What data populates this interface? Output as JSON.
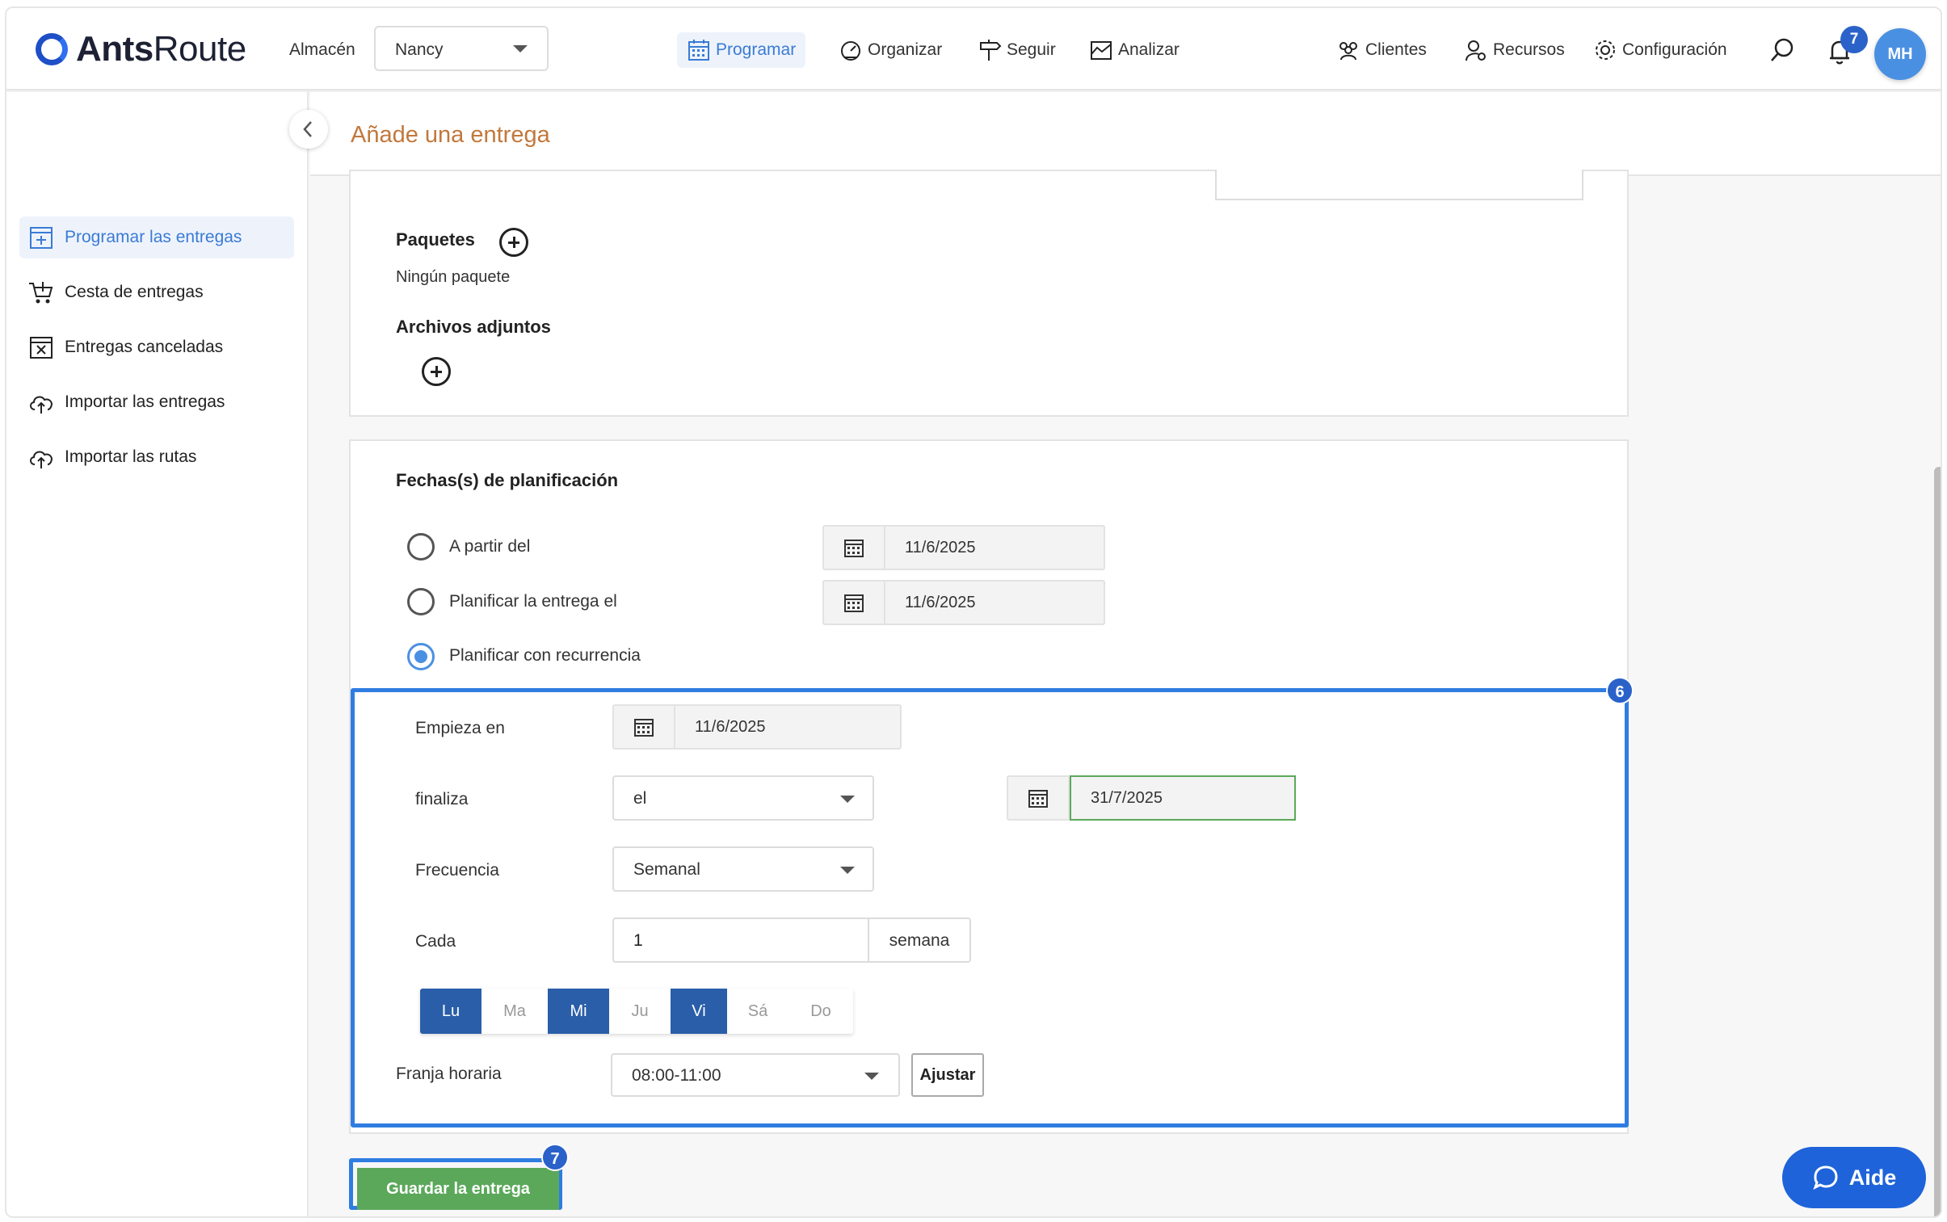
{
  "header": {
    "logo": {
      "bold": "Ants",
      "rest": "Route"
    },
    "warehouse_label": "Almacén",
    "warehouse_value": "Nancy",
    "nav": {
      "programar": "Programar",
      "organizar": "Organizar",
      "seguir": "Seguir",
      "analizar": "Analizar",
      "clientes": "Clientes",
      "recursos": "Recursos",
      "configuracion": "Configuración"
    },
    "notifications_count": "7",
    "user_initials": "MH"
  },
  "sidebar": {
    "items": [
      {
        "label": "Programar las entregas",
        "icon": "calendar-plus-icon",
        "active": true
      },
      {
        "label": "Cesta de entregas",
        "icon": "cart-icon",
        "active": false
      },
      {
        "label": "Entregas canceladas",
        "icon": "calendar-x-icon",
        "active": false
      },
      {
        "label": "Importar las entregas",
        "icon": "cloud-upload-icon",
        "active": false
      },
      {
        "label": "Importar las rutas",
        "icon": "cloud-upload-icon",
        "active": false
      }
    ]
  },
  "page": {
    "title": "Añade una entrega"
  },
  "packages": {
    "heading": "Paquetes",
    "empty": "Ningún paquete"
  },
  "attachments": {
    "heading": "Archivos adjuntos"
  },
  "planning": {
    "heading": "Fechas(s) de planificación",
    "options": [
      {
        "label": "A partir del",
        "date": "11/6/2025",
        "selected": false
      },
      {
        "label": "Planificar la entrega el",
        "date": "11/6/2025",
        "selected": false
      },
      {
        "label": "Planificar con recurrencia",
        "selected": true
      }
    ],
    "recurrence": {
      "starts_label": "Empieza en",
      "starts_value": "11/6/2025",
      "ends_label": "finaliza",
      "ends_mode": "el",
      "ends_value": "31/7/2025",
      "freq_label": "Frecuencia",
      "freq_value": "Semanal",
      "every_label": "Cada",
      "every_value": "1",
      "every_unit": "semana",
      "days": [
        {
          "label": "Lu",
          "selected": true
        },
        {
          "label": "Ma",
          "selected": false
        },
        {
          "label": "Mi",
          "selected": true
        },
        {
          "label": "Ju",
          "selected": false
        },
        {
          "label": "Vi",
          "selected": true
        },
        {
          "label": "Sá",
          "selected": false
        },
        {
          "label": "Do",
          "selected": false
        }
      ],
      "slot_label": "Franja horaria",
      "slot_value": "08:00-11:00",
      "adjust_label": "Ajustar"
    }
  },
  "steps": {
    "recurrence_step": "6",
    "save_step": "7"
  },
  "actions": {
    "save_label": "Guardar la entrega",
    "help_label": "Aide"
  },
  "colors": {
    "accent": "#2f7de1",
    "brand": "#1e4fc7",
    "title": "#c2783c",
    "save": "#5ba85a",
    "day_selected": "#2a5ea9"
  }
}
